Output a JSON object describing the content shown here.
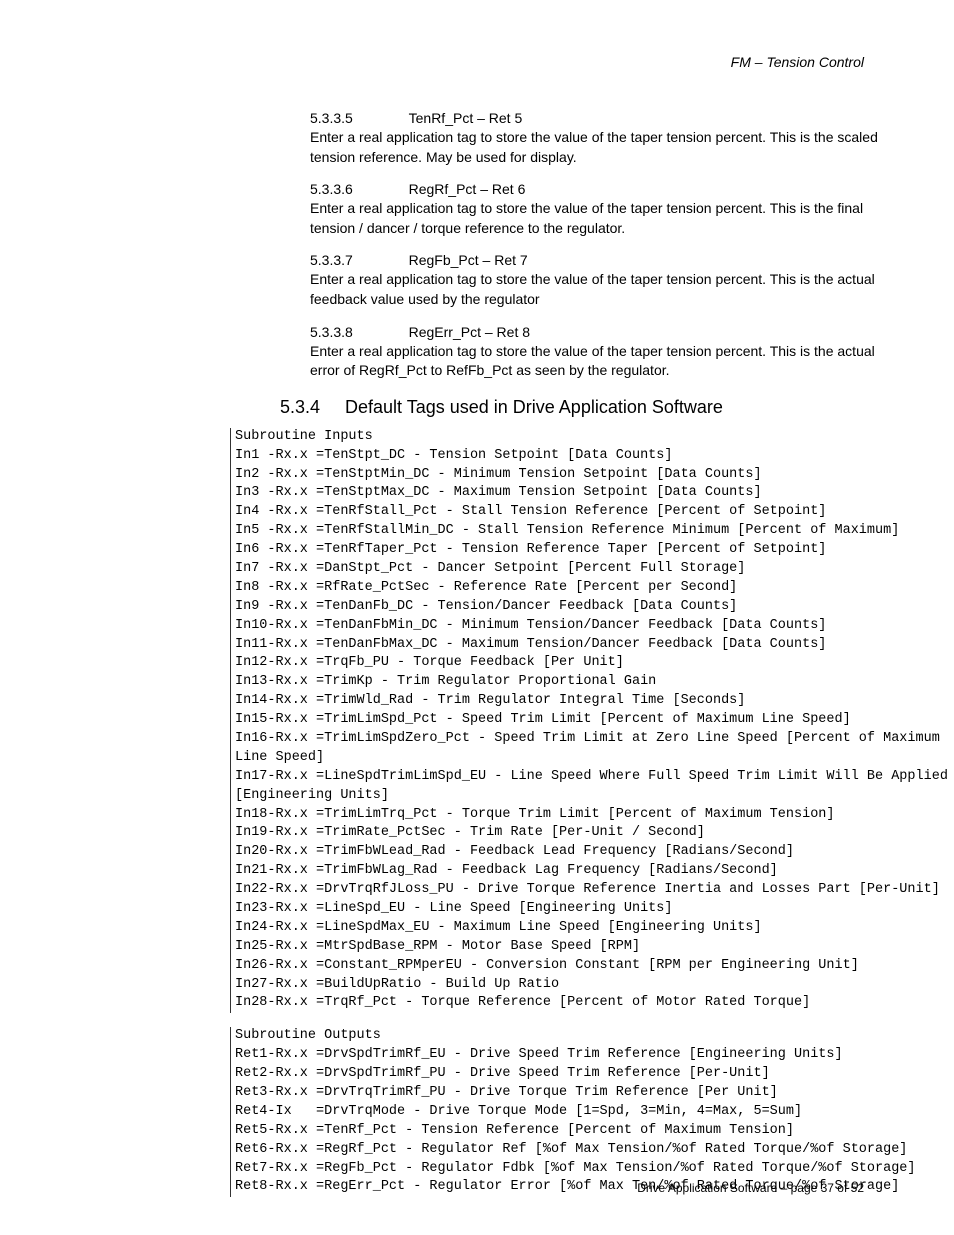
{
  "header": {
    "right": "FM – Tension Control"
  },
  "sections": [
    {
      "num": "5.3.3.5",
      "title": "TenRf_Pct – Ret 5",
      "body": "Enter a real application tag to store the value of the taper tension percent.  This is the scaled tension reference.  May be used for display."
    },
    {
      "num": "5.3.3.6",
      "title": "RegRf_Pct – Ret 6",
      "body": "Enter a real application tag to store the value of the taper tension percent.  This is the final tension / dancer / torque reference to the regulator."
    },
    {
      "num": "5.3.3.7",
      "title": "RegFb_Pct – Ret 7",
      "body": "Enter a real application tag to store the value of the taper tension percent.  This is the actual feedback value used by the regulator"
    },
    {
      "num": "5.3.3.8",
      "title": "RegErr_Pct – Ret 8",
      "body": "Enter a real application tag to store the value of the taper tension percent.  This is the actual error of RegRf_Pct to RefFb_Pct as seen by the regulator."
    }
  ],
  "heading": {
    "num": "5.3.4",
    "title": "Default Tags used in Drive Application Software"
  },
  "code_inputs": "Subroutine Inputs\nIn1 -Rx.x =TenStpt_DC - Tension Setpoint [Data Counts]\nIn2 -Rx.x =TenStptMin_DC - Minimum Tension Setpoint [Data Counts]\nIn3 -Rx.x =TenStptMax_DC - Maximum Tension Setpoint [Data Counts]\nIn4 -Rx.x =TenRfStall_Pct - Stall Tension Reference [Percent of Setpoint]\nIn5 -Rx.x =TenRfStallMin_DC - Stall Tension Reference Minimum [Percent of Maximum]\nIn6 -Rx.x =TenRfTaper_Pct - Tension Reference Taper [Percent of Setpoint]\nIn7 -Rx.x =DanStpt_Pct - Dancer Setpoint [Percent Full Storage]\nIn8 -Rx.x =RfRate_PctSec - Reference Rate [Percent per Second]\nIn9 -Rx.x =TenDanFb_DC - Tension/Dancer Feedback [Data Counts]\nIn10-Rx.x =TenDanFbMin_DC - Minimum Tension/Dancer Feedback [Data Counts]\nIn11-Rx.x =TenDanFbMax_DC - Maximum Tension/Dancer Feedback [Data Counts]\nIn12-Rx.x =TrqFb_PU - Torque Feedback [Per Unit]\nIn13-Rx.x =TrimKp - Trim Regulator Proportional Gain\nIn14-Rx.x =TrimWld_Rad - Trim Regulator Integral Time [Seconds]\nIn15-Rx.x =TrimLimSpd_Pct - Speed Trim Limit [Percent of Maximum Line Speed]\nIn16-Rx.x =TrimLimSpdZero_Pct - Speed Trim Limit at Zero Line Speed [Percent of Maximum\nLine Speed]\nIn17-Rx.x =LineSpdTrimLimSpd_EU - Line Speed Where Full Speed Trim Limit Will Be Applied\n[Engineering Units]\nIn18-Rx.x =TrimLimTrq_Pct - Torque Trim Limit [Percent of Maximum Tension]\nIn19-Rx.x =TrimRate_PctSec - Trim Rate [Per-Unit / Second]\nIn20-Rx.x =TrimFbWLead_Rad - Feedback Lead Frequency [Radians/Second]\nIn21-Rx.x =TrimFbWLag_Rad - Feedback Lag Frequency [Radians/Second]\nIn22-Rx.x =DrvTrqRfJLoss_PU - Drive Torque Reference Inertia and Losses Part [Per-Unit]\nIn23-Rx.x =LineSpd_EU - Line Speed [Engineering Units]\nIn24-Rx.x =LineSpdMax_EU - Maximum Line Speed [Engineering Units]\nIn25-Rx.x =MtrSpdBase_RPM - Motor Base Speed [RPM]\nIn26-Rx.x =Constant_RPMperEU - Conversion Constant [RPM per Engineering Unit]\nIn27-Rx.x =BuildUpRatio - Build Up Ratio\nIn28-Rx.x =TrqRf_Pct - Torque Reference [Percent of Motor Rated Torque]",
  "code_outputs": "Subroutine Outputs\nRet1-Rx.x =DrvSpdTrimRf_EU - Drive Speed Trim Reference [Engineering Units]\nRet2-Rx.x =DrvSpdTrimRf_PU - Drive Speed Trim Reference [Per-Unit]\nRet3-Rx.x =DrvTrqTrimRf_PU - Drive Torque Trim Reference [Per Unit]\nRet4-Ix   =DrvTrqMode - Drive Torque Mode [1=Spd, 3=Min, 4=Max, 5=Sum]\nRet5-Rx.x =TenRf_Pct - Tension Reference [Percent of Maximum Tension]\nRet6-Rx.x =RegRf_Pct - Regulator Ref [%of Max Tension/%of Rated Torque/%of Storage]\nRet7-Rx.x =RegFb_Pct - Regulator Fdbk [%of Max Tension/%of Rated Torque/%of Storage]\nRet8-Rx.x =RegErr_Pct - Regulator Error [%of Max Ten/%of Rated Torque/%of Storage]",
  "footer": "Drive Application Software – page 37 of 52"
}
